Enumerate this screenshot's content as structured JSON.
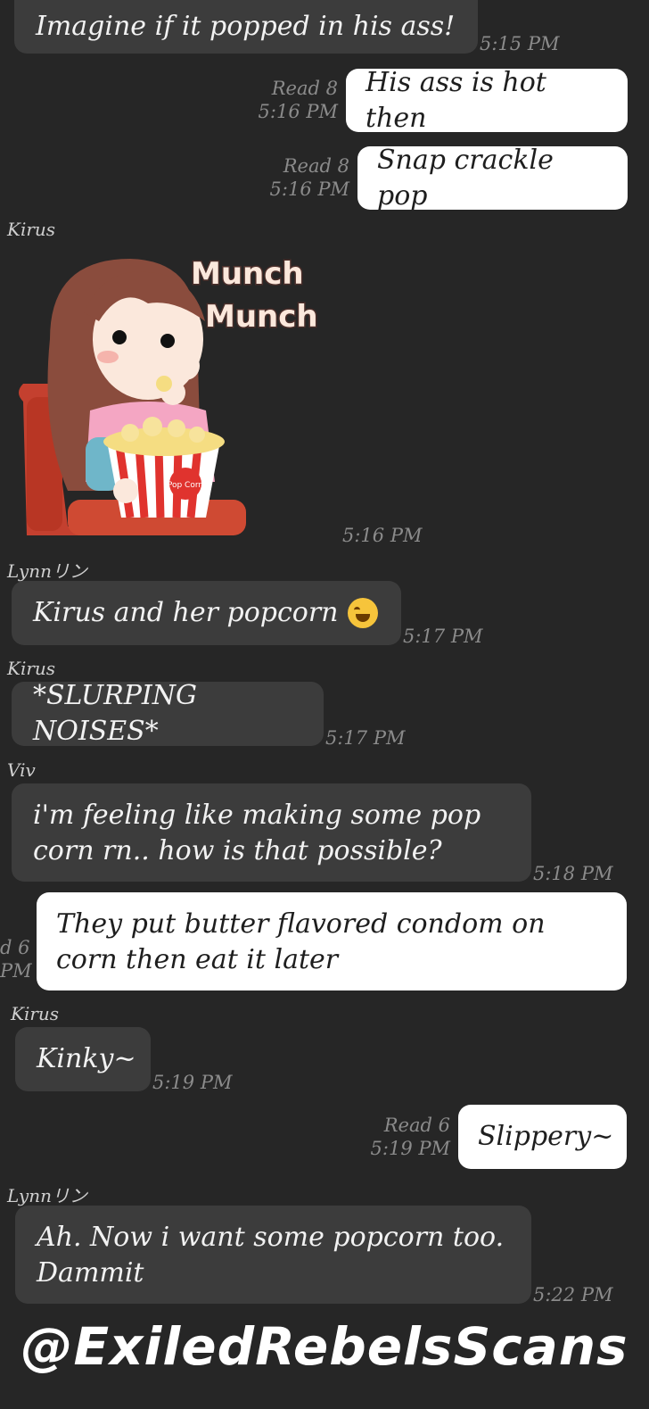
{
  "messages": [
    {
      "id": "m1",
      "text": "Imagine if it popped in his ass!",
      "time": "5:15 PM"
    },
    {
      "id": "m2",
      "text": "His ass is hot then",
      "status": "Read 8",
      "time": "5:16 PM"
    },
    {
      "id": "m3",
      "text": "Snap crackle pop",
      "status": "Read 8",
      "time": "5:16 PM"
    },
    {
      "id": "m4",
      "sender": "Kirus",
      "sticker_text_1": "Munch",
      "sticker_text_2": "Munch",
      "sticker_cup_text": "Pop Corn",
      "time": "5:16 PM"
    },
    {
      "id": "m5",
      "sender": "Lynnリン",
      "text": "Kirus and her popcorn",
      "time": "5:17 PM"
    },
    {
      "id": "m6",
      "sender": "Kirus",
      "text": "*SLURPING NOISES*",
      "time": "5:17 PM"
    },
    {
      "id": "m7",
      "sender": "Viv",
      "line1": "i'm feeling like making some pop",
      "line2": "corn rn.. how is that possible?",
      "time": "5:18 PM"
    },
    {
      "id": "m8",
      "line1": "They put butter flavored condom on",
      "line2": "corn then eat it later",
      "status": "d 6",
      "time": "PM"
    },
    {
      "id": "m9",
      "sender": "Kirus",
      "text": "Kinky~",
      "time": "5:19 PM"
    },
    {
      "id": "m10",
      "text": "Slippery~",
      "status": "Read 6",
      "time": "5:19 PM"
    },
    {
      "id": "m11",
      "sender": "Lynnリン",
      "line1": "Ah. Now i want some popcorn too.",
      "line2": "Dammit",
      "time": "5:22 PM"
    }
  ],
  "emoji_icon": "grinning-sweat-emoji",
  "watermark": "@ExiledRebelsScans"
}
